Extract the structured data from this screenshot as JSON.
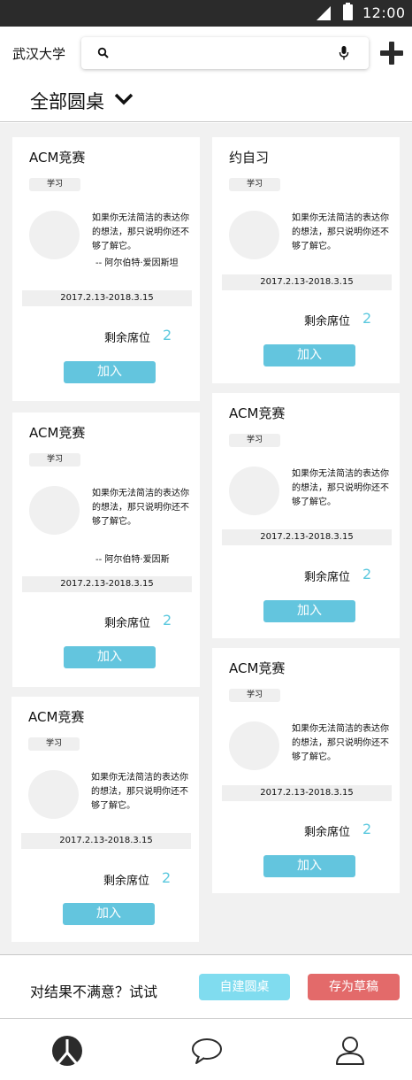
{
  "status_bar": {
    "time": "12:00",
    "signal_icon": "signal-icon",
    "battery_icon": "battery-icon"
  },
  "header": {
    "school": "武汉大学",
    "search_placeholder": "",
    "search_icon": "search-icon",
    "mic_icon": "microphone-icon",
    "add_icon": "plus-icon"
  },
  "filter": {
    "label": "全部圆桌",
    "icon": "chevron-down-icon"
  },
  "cards": [
    {
      "title": "ACM竞赛",
      "tag": "学习",
      "quote": "如果你无法简洁的表达你的想法，那只说明你还不够了解它。",
      "author": "-- 阿尔伯特·爱因斯坦",
      "dates": "2017.2.13-2018.3.15",
      "seats_label": "剩余席位",
      "seats": "2",
      "join": "加入"
    },
    {
      "title": "ACM竞赛",
      "tag": "学习",
      "quote": "如果你无法简洁的表达你的想法，那只说明你还不够了解它。",
      "author": "-- 阿尔伯特·爱因斯",
      "dates": "2017.2.13-2018.3.15",
      "seats_label": "剩余席位",
      "seats": "2",
      "join": "加入"
    },
    {
      "title": "ACM竞赛",
      "tag": "学习",
      "quote": "如果你无法简洁的表达你的想法，那只说明你还不够了解它。",
      "author": "",
      "dates": "2017.2.13-2018.3.15",
      "seats_label": "剩余席位",
      "seats": "2",
      "join": "加入"
    },
    {
      "title": "约自习",
      "tag": "学习",
      "quote": "如果你无法简洁的表达你的想法，那只说明你还不够了解它。",
      "author": "",
      "dates": "2017.2.13-2018.3.15",
      "seats_label": "剩余席位",
      "seats": "2",
      "join": "加入"
    },
    {
      "title": "ACM竞赛",
      "tag": "学习",
      "quote": "如果你无法简洁的表达你的想法，那只说明你还不够了解它。",
      "author": "",
      "dates": "2017.2.13-2018.3.15",
      "seats_label": "剩余席位",
      "seats": "2",
      "join": "加入"
    },
    {
      "title": "ACM竞赛",
      "tag": "学习",
      "quote": "如果你无法简洁的表达你的想法，那只说明你还不够了解它。",
      "author": "",
      "dates": "2017.2.13-2018.3.15",
      "seats_label": "剩余席位",
      "seats": "2",
      "join": "加入"
    }
  ],
  "bottom_bar": {
    "prompt": "对结果不满意？试试",
    "create": "自建圆桌",
    "draft": "存为草稿"
  },
  "tab_bar": {
    "icons": [
      "roundtable-icon",
      "chat-bubble-icon",
      "profile-icon"
    ]
  },
  "colors": {
    "accent": "#63c5de",
    "create": "#80dcef",
    "draft": "#e36a6a",
    "seat_count": "#5bc8de"
  }
}
